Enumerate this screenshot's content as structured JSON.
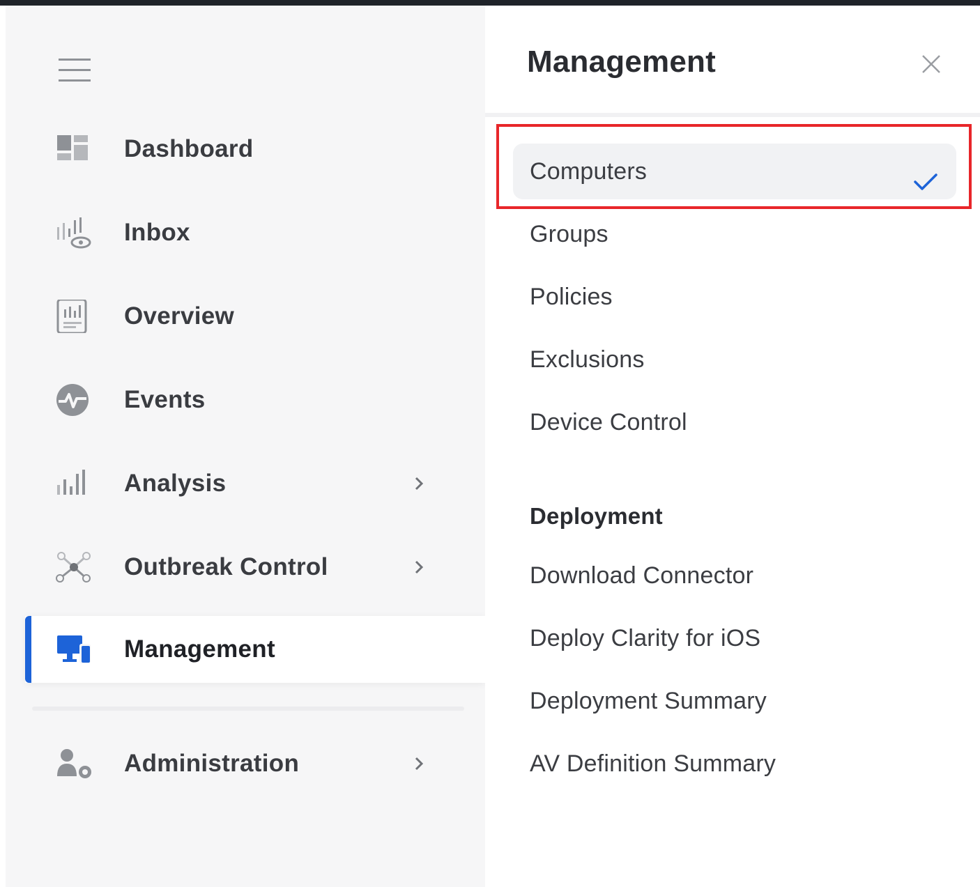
{
  "sidebar": {
    "items": [
      {
        "label": "Dashboard",
        "icon": "dashboard-icon",
        "has_submenu": false,
        "active": false
      },
      {
        "label": "Inbox",
        "icon": "inbox-eye-icon",
        "has_submenu": false,
        "active": false
      },
      {
        "label": "Overview",
        "icon": "report-icon",
        "has_submenu": false,
        "active": false
      },
      {
        "label": "Events",
        "icon": "heartbeat-icon",
        "has_submenu": false,
        "active": false
      },
      {
        "label": "Analysis",
        "icon": "bar-chart-icon",
        "has_submenu": true,
        "active": false
      },
      {
        "label": "Outbreak Control",
        "icon": "network-icon",
        "has_submenu": true,
        "active": false
      },
      {
        "label": "Management",
        "icon": "devices-icon",
        "has_submenu": false,
        "active": true
      },
      {
        "label": "Administration",
        "icon": "user-gear-icon",
        "has_submenu": true,
        "active": false
      }
    ]
  },
  "panel": {
    "title": "Management",
    "items": [
      {
        "label": "Computers",
        "selected": true
      },
      {
        "label": "Groups",
        "selected": false
      },
      {
        "label": "Policies",
        "selected": false
      },
      {
        "label": "Exclusions",
        "selected": false
      },
      {
        "label": "Device Control",
        "selected": false
      }
    ],
    "deployment": {
      "header": "Deployment",
      "items": [
        {
          "label": "Download Connector"
        },
        {
          "label": "Deploy Clarity for iOS"
        },
        {
          "label": "Deployment Summary"
        },
        {
          "label": "AV Definition Summary"
        }
      ]
    }
  },
  "colors": {
    "accent": "#1d63d8",
    "highlight": "#e8262a",
    "icon_gray": "#8e9196",
    "sidebar_bg": "#f6f6f7"
  }
}
